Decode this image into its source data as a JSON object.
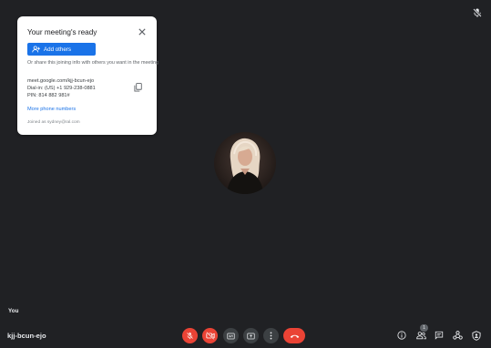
{
  "meeting_card": {
    "title": "Your meeting's ready",
    "add_others_label": "Add others",
    "share_text": "Or share this joining info with others you want in the meeting",
    "meeting_link": "meet.google.com/kjj-bcun-ejo",
    "dial_in": "Dial-in: (US) +1 929-238-0881",
    "pin": "PIN: 814 882 981#",
    "more_numbers_label": "More phone numbers",
    "joined_as": "Joined as sydney@ral.com"
  },
  "participant": {
    "self_label": "You"
  },
  "bottom_bar": {
    "meeting_code": "kjj-bcun-ejo",
    "participant_count": "1"
  },
  "colors": {
    "background": "#202124",
    "accent": "#1a73e8",
    "danger": "#ea4335",
    "control_grey": "#3c4043"
  },
  "icons": {
    "top_right": "mic-off-icon",
    "controls": [
      "mic-off-icon",
      "camera-off-icon",
      "captions-icon",
      "present-screen-icon",
      "more-options-icon",
      "leave-call-icon"
    ],
    "side": [
      "info-icon",
      "people-icon",
      "chat-icon",
      "activities-icon",
      "host-controls-icon"
    ]
  }
}
